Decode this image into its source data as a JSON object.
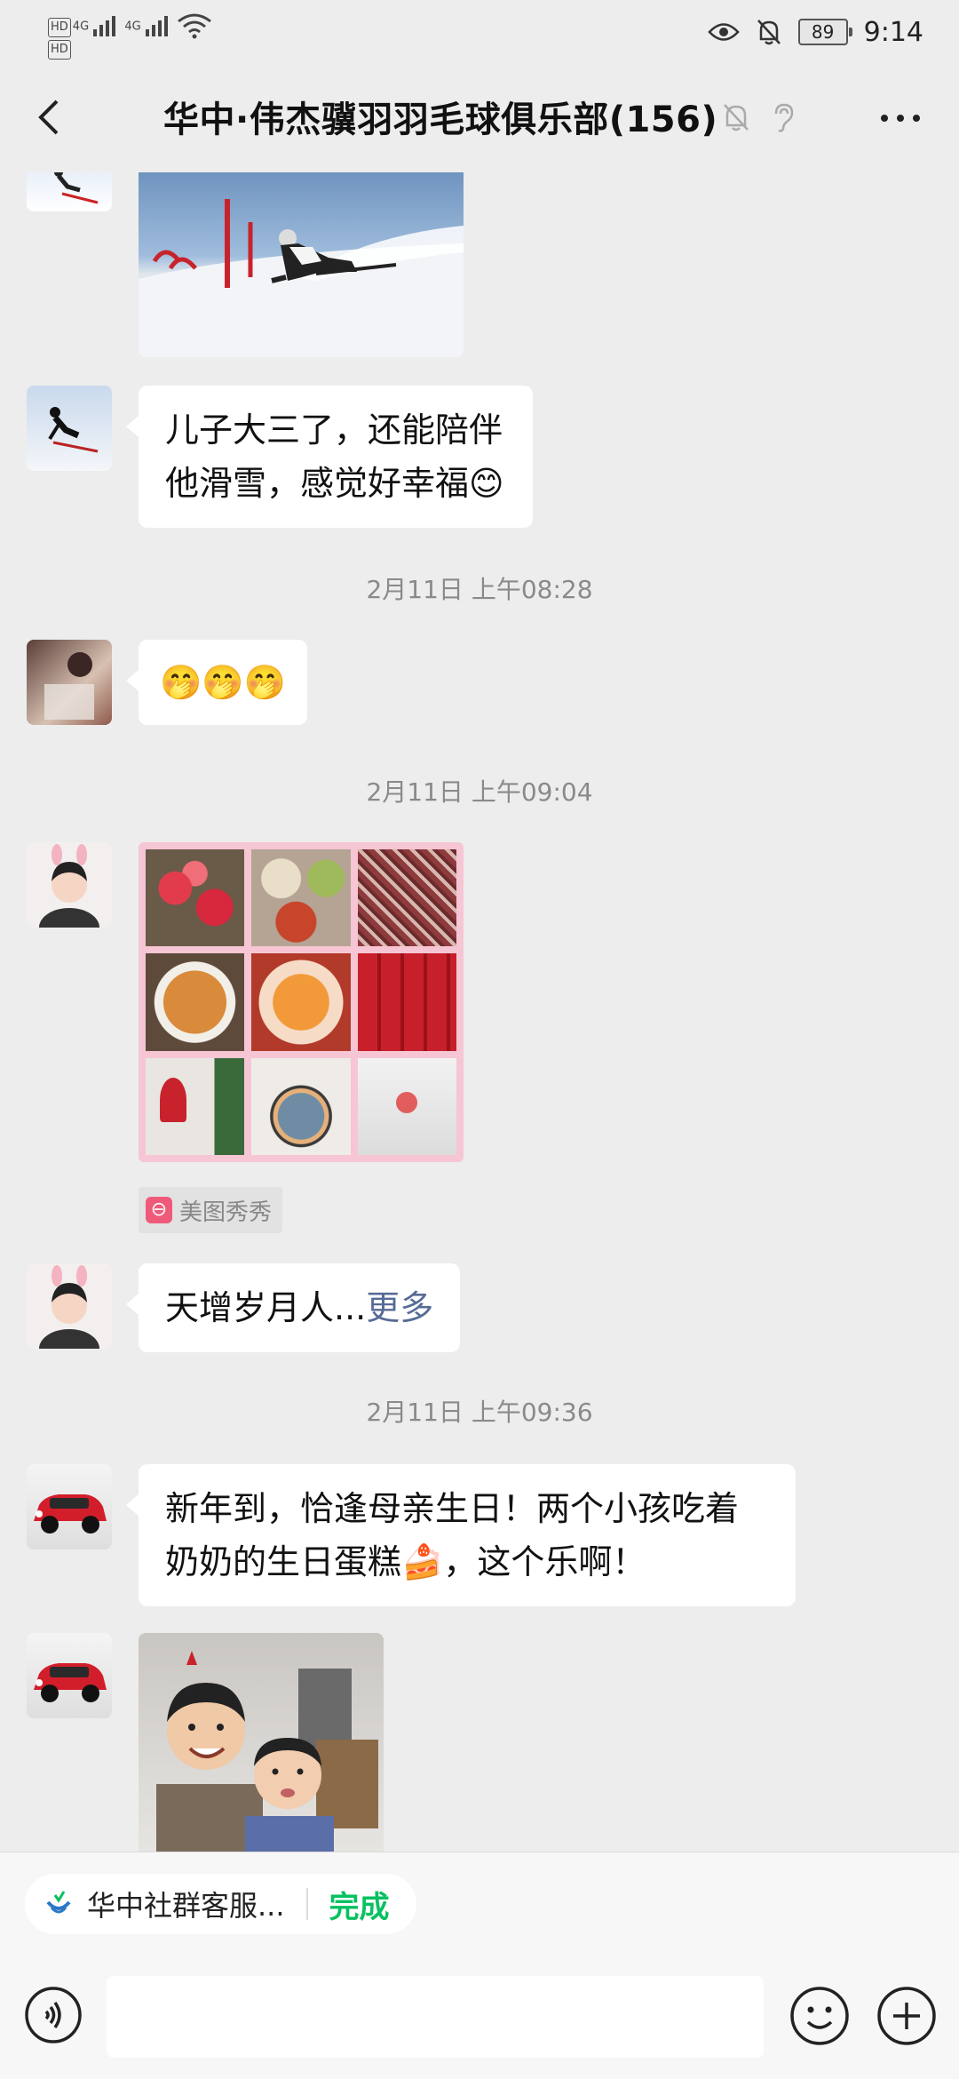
{
  "status_bar": {
    "hd1": "HD",
    "hd2": "HD",
    "net1": "4G",
    "net2": "4G",
    "battery": "89",
    "time": "9:14"
  },
  "header": {
    "title": "华中·伟杰骥羽羽毛球俱乐部(156)"
  },
  "messages": {
    "m1_text": "儿子大三了，还能陪伴他滑雪，感觉好幸福😊",
    "t1": "2月11日 上午08:28",
    "m2_text": "🤭🤭🤭",
    "t2": "2月11日 上午09:04",
    "app_source": "美图秀秀",
    "m4_text": "天增岁月人...",
    "m4_more": "更多",
    "t3": "2月11日 上午09:36",
    "m5_text": "新年到，恰逢母亲生日！两个小孩吃着奶奶的生日蛋糕🍰，这个乐啊！"
  },
  "mini_program": {
    "name": "华中社群客服...",
    "done": "完成"
  },
  "colors": {
    "background": "#ededed",
    "bubble": "#ffffff",
    "accent_green": "#07c160",
    "link": "#576b95"
  }
}
